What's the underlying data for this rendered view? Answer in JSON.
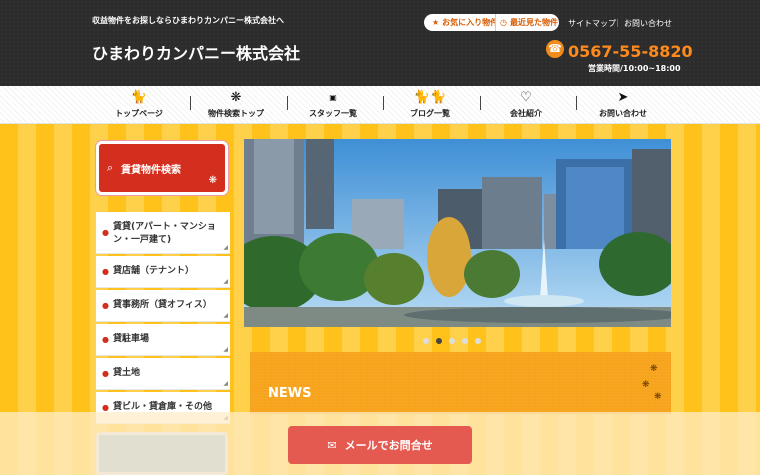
{
  "header": {
    "tagline": "収益物件をお探しならひまわりカンパニー株式会社へ",
    "logo": "ひまわりカンパニー株式会社",
    "favorites_label": "お気に入り物件",
    "recent_label": "最近見た物件",
    "sitemap_label": "サイトマップ",
    "contact_label": "お問い合わせ",
    "phone": "0567-55-8820",
    "hours": "営業時間/10:00~18:00"
  },
  "nav": [
    {
      "label": "トップページ",
      "icon": "cat-icon"
    },
    {
      "label": "物件検索トップ",
      "icon": "paw-icon"
    },
    {
      "label": "スタッフ一覧",
      "icon": "milk-icon"
    },
    {
      "label": "ブログ一覧",
      "icon": "cats-icon"
    },
    {
      "label": "会社紹介",
      "icon": "heart-icon"
    },
    {
      "label": "お問い合わせ",
      "icon": "fish-icon"
    }
  ],
  "sidebar": {
    "search_title": "賃貸物件検索",
    "items": [
      {
        "label": "賃貸(アパート・マンション・一戸建て)"
      },
      {
        "label": "貸店舗（テナント）"
      },
      {
        "label": "貸事務所（貸オフィス）"
      },
      {
        "label": "貸駐車場"
      },
      {
        "label": "貸土地"
      },
      {
        "label": "貸ビル・貸倉庫・その他"
      }
    ]
  },
  "slider": {
    "total": 5,
    "active": 1
  },
  "news": {
    "title": "NEWS"
  },
  "cta": {
    "mail_label": "メールでお問合せ"
  },
  "colors": {
    "accent": "#d42f1e",
    "orange": "#f7a41c",
    "phone": "#ff8a1c",
    "button": "#e45a50"
  }
}
